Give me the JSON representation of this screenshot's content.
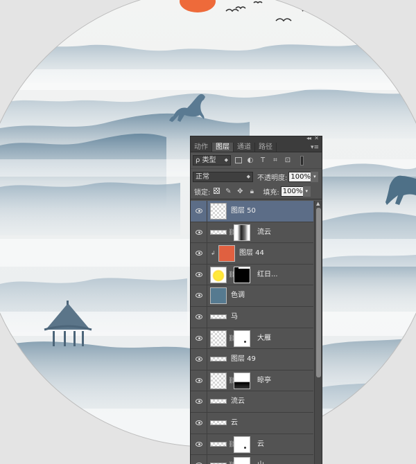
{
  "panel": {
    "tabs": [
      {
        "label": "动作",
        "active": false
      },
      {
        "label": "图层",
        "active": true
      },
      {
        "label": "通道",
        "active": false
      },
      {
        "label": "路径",
        "active": false
      }
    ],
    "filter": {
      "kind_label": "ρ 类型"
    },
    "blend_mode": "正常",
    "opacity_label": "不透明度:",
    "opacity_value": "100%",
    "lock_label": "锁定:",
    "fill_label": "填充:",
    "fill_value": "100%"
  },
  "layers": [
    {
      "name": "图层 50",
      "selected": true
    },
    {
      "name": "流云",
      "selected": false
    },
    {
      "name": "图层 44",
      "selected": false
    },
    {
      "name": "红日...",
      "selected": false
    },
    {
      "name": "色调",
      "selected": false
    },
    {
      "name": "马",
      "selected": false
    },
    {
      "name": "大雁",
      "selected": false
    },
    {
      "name": "图层 49",
      "selected": false
    },
    {
      "name": "晾亭",
      "selected": false
    },
    {
      "name": "流云",
      "selected": false
    },
    {
      "name": "云",
      "selected": false
    },
    {
      "name": "云",
      "selected": false
    },
    {
      "name": "山",
      "selected": false
    }
  ],
  "colors": {
    "accent_selected": "#5c6d87",
    "panel_bg": "#535353",
    "sun": "#ee6a3a",
    "mountain": "#6f8fa6"
  }
}
